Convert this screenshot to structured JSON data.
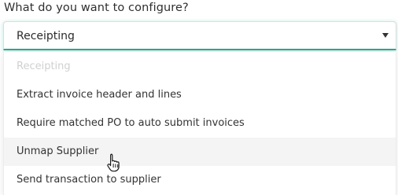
{
  "form": {
    "question": "What do you want to configure?"
  },
  "select": {
    "selected_value": "Receipting",
    "caret_icon": "caret-down-icon"
  },
  "menu": {
    "options": [
      {
        "label": "Receipting",
        "state": "disabled"
      },
      {
        "label": "Extract invoice header and lines",
        "state": "normal"
      },
      {
        "label": "Require matched PO to auto submit invoices",
        "state": "normal"
      },
      {
        "label": "Unmap Supplier",
        "state": "hovered"
      },
      {
        "label": "Send transaction to supplier",
        "state": "normal"
      }
    ]
  },
  "cursor": {
    "icon": "hand-pointer-icon"
  },
  "colors": {
    "accent": "#2ea98f",
    "hover_bg": "#f4f4f4",
    "disabled_text": "#d0d0d0"
  }
}
